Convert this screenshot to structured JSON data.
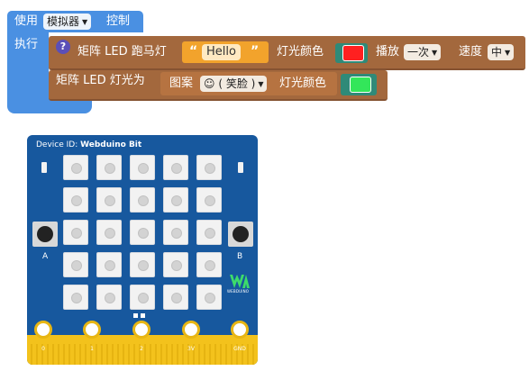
{
  "main_block": {
    "use_label": "使用",
    "device_dropdown": "模拟器",
    "control_label": "控制",
    "execute_label": "执行"
  },
  "marquee_statement": {
    "help_icon": "?",
    "label": "矩阵 LED 跑马灯",
    "text_value": "Hello",
    "color_label": "灯光颜色",
    "color": "#ff2020",
    "play_label": "播放",
    "play_dropdown": "一次",
    "speed_label": "速度",
    "speed_dropdown": "中"
  },
  "led_statement": {
    "label": "矩阵 LED 灯光为",
    "pattern_label": "图案",
    "pattern_dropdown": "☺ ( 笑脸 )",
    "color_label": "灯光颜色",
    "color": "#33e65a"
  },
  "board": {
    "device_id_label": "Device ID:",
    "device_name": "Webduino Bit",
    "button_a_label": "A",
    "button_b_label": "B",
    "logo_text": "WEBDUINO",
    "led_rows": 5,
    "led_cols": 5,
    "pins": [
      "0",
      "1",
      "2",
      "3V",
      "GND"
    ]
  },
  "colors": {
    "main_block": "#4a90e2",
    "statement_block": "#a3683d",
    "text_block": "#f2a32c",
    "color_block": "#2f8a78",
    "board": "#17589e",
    "gold_edge": "#f3c21c"
  }
}
